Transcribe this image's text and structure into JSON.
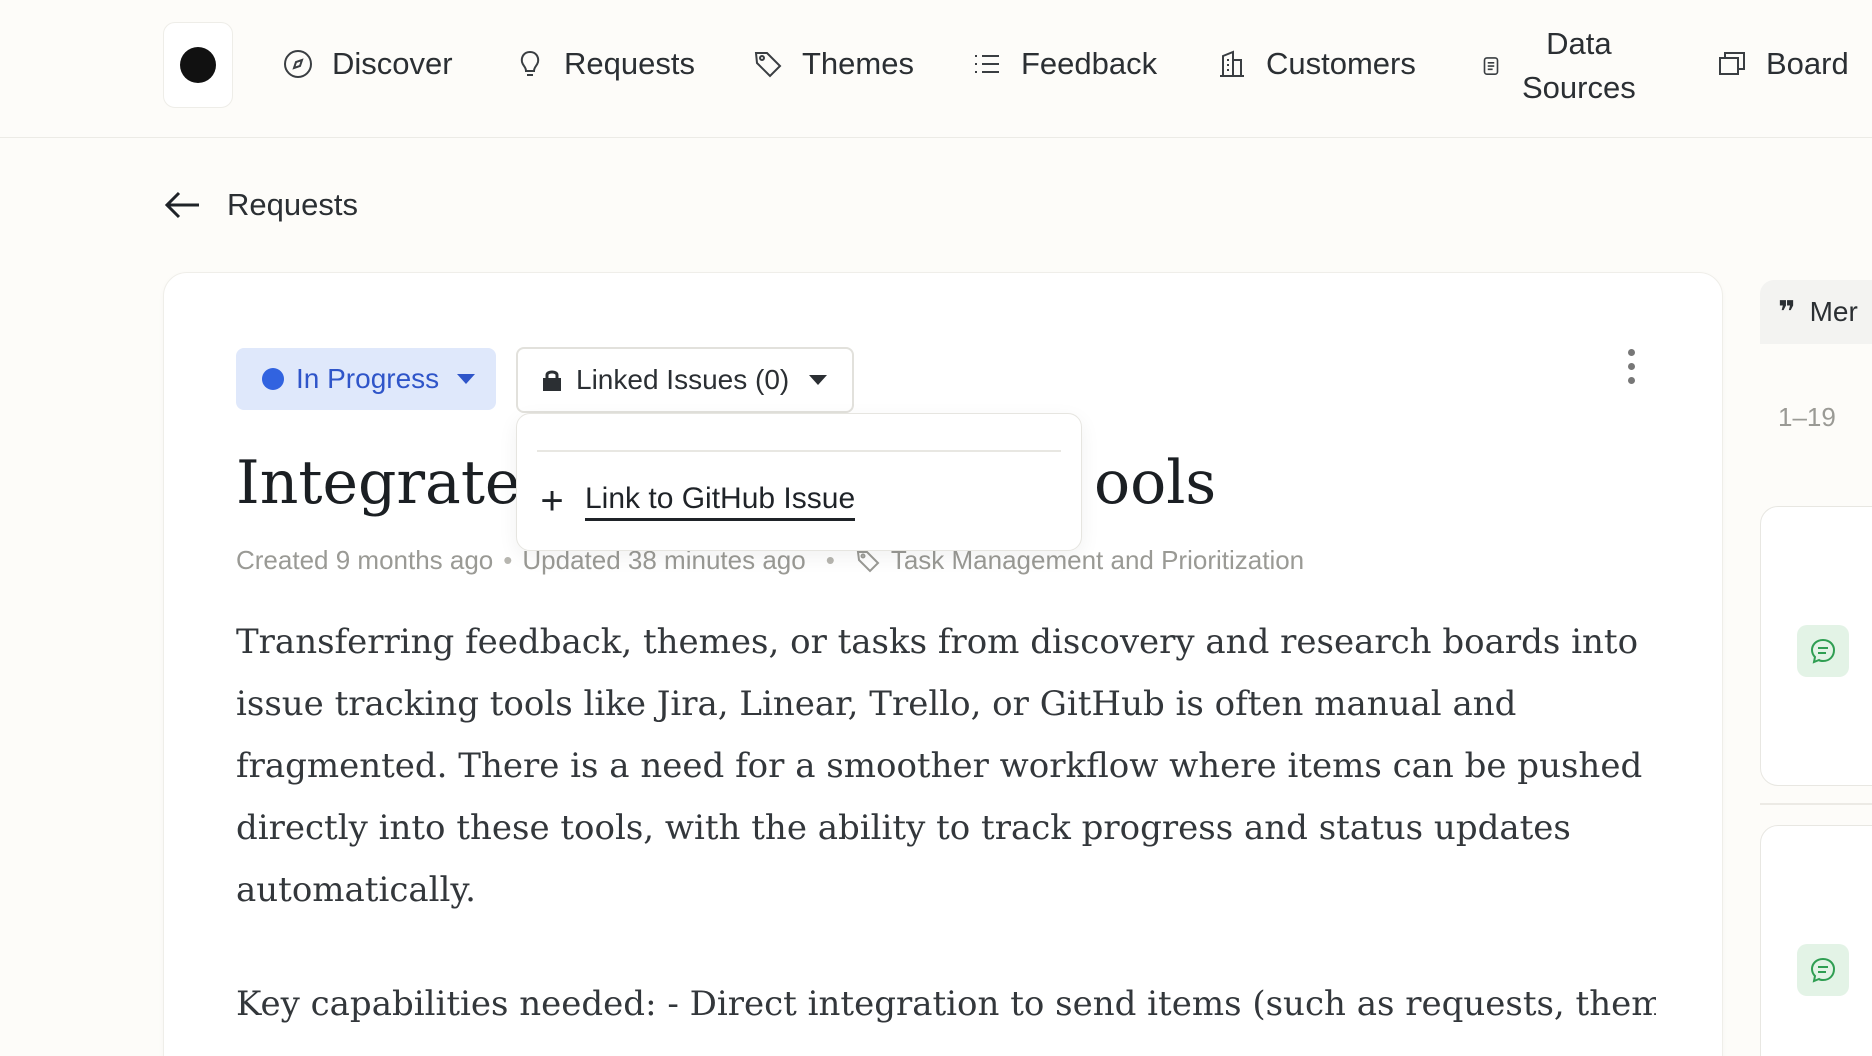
{
  "nav": {
    "items": [
      {
        "label": "Discover",
        "icon": "compass-icon"
      },
      {
        "label": "Requests",
        "icon": "lightbulb-icon"
      },
      {
        "label": "Themes",
        "icon": "tag-icon"
      },
      {
        "label": "Feedback",
        "icon": "list-icon"
      },
      {
        "label": "Customers",
        "icon": "building-icon"
      },
      {
        "label_line1": "Data",
        "label_line2": "Sources",
        "icon": "database-icon"
      },
      {
        "label": "Board",
        "icon": "board-icon"
      }
    ]
  },
  "back": {
    "label": "Requests"
  },
  "request": {
    "status": "In Progress",
    "status_color": "#3163e0",
    "linked_issues_label": "Linked Issues (0)",
    "title_left": "Integrate ",
    "title_right": "ools",
    "created": "Created 9 months ago",
    "updated": "Updated 38 minutes ago",
    "tag": "Task Management and Prioritization",
    "description": "Transferring feedback, themes, or tasks from discovery and research boards into issue tracking tools like Jira, Linear, Trello, or GitHub is often manual and fragmented. There is a need for a smoother workflow where items can be pushed directly into these tools, with the ability to track progress and status updates automatically.",
    "key_capabilities": "Key capabilities needed: - Direct integration to send items (such as requests, themes,"
  },
  "dropdown": {
    "item_label": "Link to GitHub Issue"
  },
  "side_panel": {
    "header_label": "Mer",
    "range": "1–19"
  }
}
